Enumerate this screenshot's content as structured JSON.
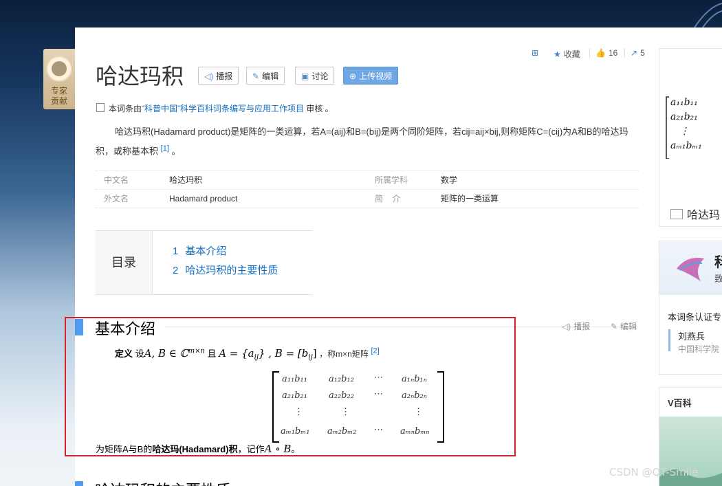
{
  "expert": {
    "label_line1": "专家",
    "label_line2": "贡献"
  },
  "title": "哈达玛积",
  "buttons": {
    "play": "播报",
    "edit": "编辑",
    "discuss": "讨论",
    "upload": "上传视频"
  },
  "actions": {
    "collect": "收藏",
    "like_count": "16",
    "share_count": "5"
  },
  "review": {
    "prefix": "本词条由",
    "org": "“科普中国”科学百科词条编写与应用工作项目",
    "suffix": " 审核 。"
  },
  "summary": {
    "text": "哈达玛积(Hadamard product)是矩阵的一类运算，若A=(aij)和B=(bij)是两个同阶矩阵，若cij=aij×bij,则称矩阵C=(cij)为A和B的哈达玛积，或称基本积",
    "ref": "[1]",
    "end": " 。"
  },
  "basic_info": [
    {
      "k1": "中文名",
      "v1": "哈达玛积",
      "k2": "所属学科",
      "v2": "数学"
    },
    {
      "k1": "外文名",
      "v1": "Hadamard product",
      "k2": "简    介",
      "v2": "矩阵的一类运算"
    }
  ],
  "toc": {
    "label": "目录",
    "items": [
      {
        "num": "1",
        "text": "基本介绍"
      },
      {
        "num": "2",
        "text": "哈达玛积的主要性质"
      }
    ]
  },
  "section1": {
    "title": "基本介绍",
    "tool_play": "播报",
    "tool_edit": "编辑",
    "def_bold": "定义",
    "def_she": " 设",
    "def_set": "A, B ∈ ℂ",
    "def_sup": "m×n",
    "def_and": " 且",
    "def_a": "A = {a",
    "def_ij": "ij",
    "def_b": "}  , B = [b",
    "def_ij2": "ij",
    "def_end": "]",
    "def_tail": "，称m×n矩阵",
    "def_ref": "[2]",
    "matrix": {
      "r1": [
        "a₁₁b₁₁",
        "a₁₂b₁₂",
        "⋯",
        "a₁ₙb₁ₙ"
      ],
      "r2": [
        "a₂₁b₂₁",
        "a₂₂b₂₂",
        "⋯",
        "a₂ₙb₂ₙ"
      ],
      "r3": [
        "⋮",
        "⋮",
        "",
        "⋮"
      ],
      "r4": [
        "aₘ₁bₘ₁",
        "aₘ₂bₘ₂",
        "⋯",
        "aₘₙbₘₙ"
      ]
    },
    "after_pre": "为矩阵A与B的",
    "after_bold": "哈达玛(Hadamard)积",
    "after_mid": "，记作",
    "after_math": "A ∘ B",
    "after_end": "。"
  },
  "section2": {
    "title": "哈达玛积的主要性质"
  },
  "right": {
    "card1_caption": "哈达玛",
    "card2_title": "科",
    "card2_sub": "致",
    "card2_cert": "本词条认证专",
    "card2_person": "刘燕兵",
    "card2_org": "中国科学院",
    "card3_title": "V百科"
  },
  "watermark": "CSDN @QT-Smile"
}
